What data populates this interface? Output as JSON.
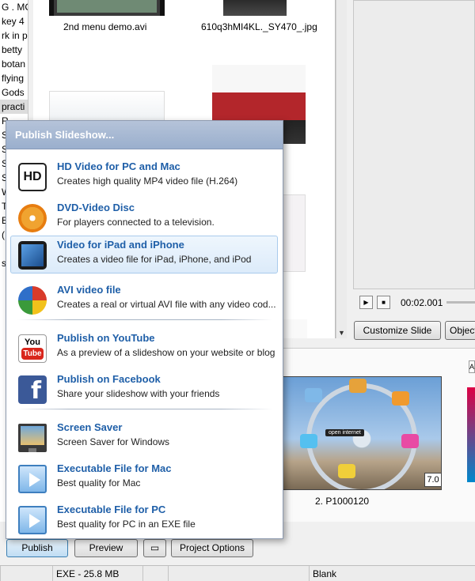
{
  "tree": {
    "items": [
      {
        "label": "G . MC",
        "selected": false
      },
      {
        "label": "key 4",
        "selected": false
      },
      {
        "label": "rk in p",
        "selected": false
      },
      {
        "label": "betty",
        "selected": false
      },
      {
        "label": "botan",
        "selected": false
      },
      {
        "label": "flying",
        "selected": false
      },
      {
        "label": "Gods",
        "selected": false
      },
      {
        "label": "practi",
        "selected": true
      },
      {
        "label": "R",
        "selected": false
      },
      {
        "label": "S",
        "selected": false
      },
      {
        "label": "S",
        "selected": false
      },
      {
        "label": "S",
        "selected": false
      },
      {
        "label": "S",
        "selected": false
      },
      {
        "label": "W",
        "selected": false
      },
      {
        "label": "T",
        "selected": false
      },
      {
        "label": "Ec",
        "selected": false
      },
      {
        "label": "(",
        "selected": false
      },
      {
        "label": "",
        "selected": false
      },
      {
        "label": "s",
        "selected": false
      }
    ]
  },
  "browser": {
    "files": [
      {
        "caption": "2nd menu demo.avi"
      },
      {
        "caption": "610q3hMI4KL._SY470_.jpg"
      }
    ]
  },
  "player": {
    "play_icon": "play-icon",
    "stop_icon": "stop-icon",
    "time": "00:02.001"
  },
  "slide_buttons": {
    "customize": "Customize Slide",
    "objects": "Object"
  },
  "timeline": {
    "slide_caption": "2. P1000120",
    "duration": "7.0",
    "photo_overlay_text": "open internet",
    "side_tab": "A"
  },
  "publish_menu": {
    "title": "Publish Slideshow...",
    "highlighted_index": 2,
    "options": [
      {
        "icon": "hd-icon",
        "icon_text": "HD",
        "title": "HD Video for PC and Mac",
        "desc": "Creates high quality MP4 video file (H.264)"
      },
      {
        "icon": "dvd-icon",
        "title": "DVD-Video Disc",
        "desc": "For players connected to a television."
      },
      {
        "icon": "ipad-iphone-icon",
        "title": "Video for iPad and iPhone",
        "desc": "Creates a video file for iPad, iPhone, and iPod"
      },
      {
        "icon": "avi-film-icon",
        "title": "AVI video file",
        "desc": "Creates a real or virtual AVI file with any video cod..."
      },
      {
        "icon": "youtube-icon",
        "icon_text_top": "You",
        "icon_text_bottom": "Tube",
        "title": "Publish on YouTube",
        "desc": "As a preview of a slideshow on your website or blog"
      },
      {
        "icon": "facebook-icon",
        "icon_text": "f",
        "title": "Publish on Facebook",
        "desc": "Share your slideshow with your friends"
      },
      {
        "icon": "monitor-icon",
        "title": "Screen Saver",
        "desc": "Screen Saver for Windows"
      },
      {
        "icon": "exe-play-icon",
        "title": "Executable File for Mac",
        "desc": "Best quality for Mac"
      },
      {
        "icon": "exe-play-icon",
        "title": "Executable File for PC",
        "desc": "Best quality for PC in an EXE file"
      }
    ]
  },
  "toolbar": {
    "publish": "Publish",
    "preview": "Preview",
    "fullscreen_icon": "fullscreen-icon",
    "project_options": "Project Options"
  },
  "statusbar": {
    "size": "EXE - 25.8 MB",
    "theme": "Blank"
  }
}
